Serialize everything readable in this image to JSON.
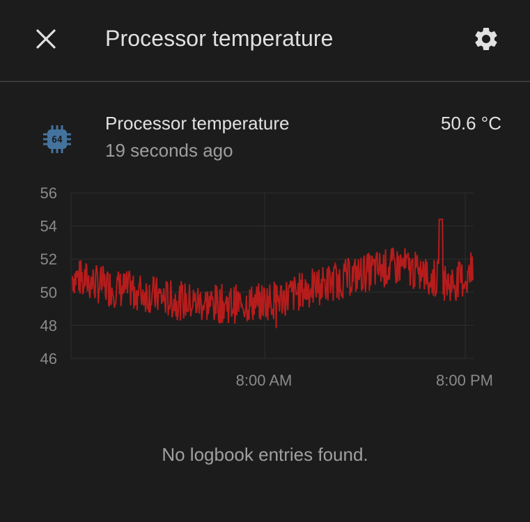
{
  "header": {
    "title": "Processor temperature",
    "close_icon": "close-icon",
    "settings_icon": "gear-icon"
  },
  "entity": {
    "icon": "chip-icon",
    "icon_color": "#44739e",
    "name": "Processor temperature",
    "last_changed": "19 seconds ago",
    "state": "50.6 °C"
  },
  "chart_data": {
    "type": "line",
    "ylim": [
      46,
      56
    ],
    "y_ticks": [
      "56",
      "54",
      "52",
      "50",
      "48",
      "46"
    ],
    "x_ticks": [
      "8:00 AM",
      "8:00 PM"
    ],
    "series_color": "#b71c1c",
    "grid": true,
    "series": [
      {
        "values": [
          51.0,
          50.5,
          50.2,
          50.0,
          49.6,
          49.4,
          49.3,
          49.3,
          49.4,
          49.7,
          50.2,
          50.6,
          51.0,
          51.4,
          51.6,
          51.0,
          50.5,
          51.0
        ]
      }
    ]
  },
  "logbook": {
    "empty_text": "No logbook entries found."
  }
}
